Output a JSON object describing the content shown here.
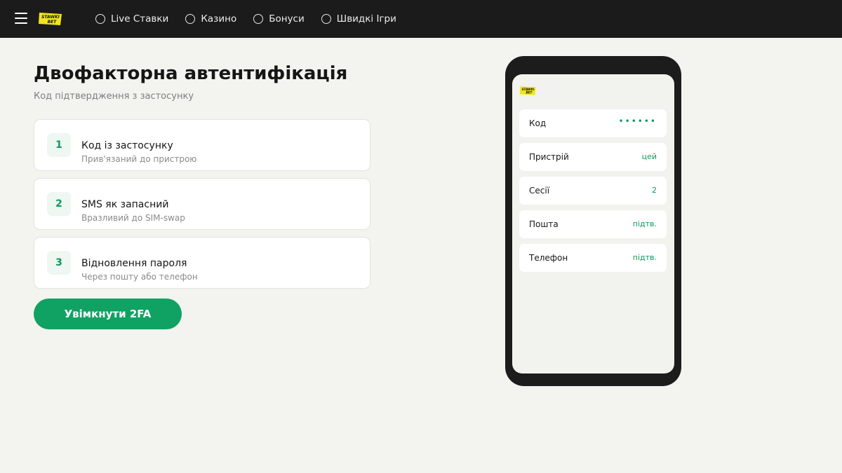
{
  "nav": {
    "items": [
      {
        "label": "Live Ставки"
      },
      {
        "label": "Казино"
      },
      {
        "label": "Бонуси"
      },
      {
        "label": "Швидкі Ігри"
      }
    ]
  },
  "logo": {
    "line1": "STAWKI",
    "line2": "BET",
    "color": "#f2e51c"
  },
  "page": {
    "title": "Двофакторна автентифікація",
    "subtitle": "Код підтвердження з застосунку"
  },
  "steps": [
    {
      "num": "1",
      "title": "Код із застосунку",
      "desc": "Прив'язаний до пристрою"
    },
    {
      "num": "2",
      "title": "SMS як запасний",
      "desc": "Вразливий до SIM-swap"
    },
    {
      "num": "3",
      "title": "Відновлення пароля",
      "desc": "Через пошту або телефон"
    }
  ],
  "cta": {
    "label": "Увімкнути 2FA"
  },
  "phone": {
    "rows": [
      {
        "key": "Код",
        "value": "••••••"
      },
      {
        "key": "Пристрій",
        "value": "цей"
      },
      {
        "key": "Сесії",
        "value": "2"
      },
      {
        "key": "Пошта",
        "value": "підтв."
      },
      {
        "key": "Телефон",
        "value": "підтв."
      }
    ]
  },
  "colors": {
    "accent": "#10a263",
    "topbar": "#1b1b1b",
    "background": "#f3f3ef"
  }
}
